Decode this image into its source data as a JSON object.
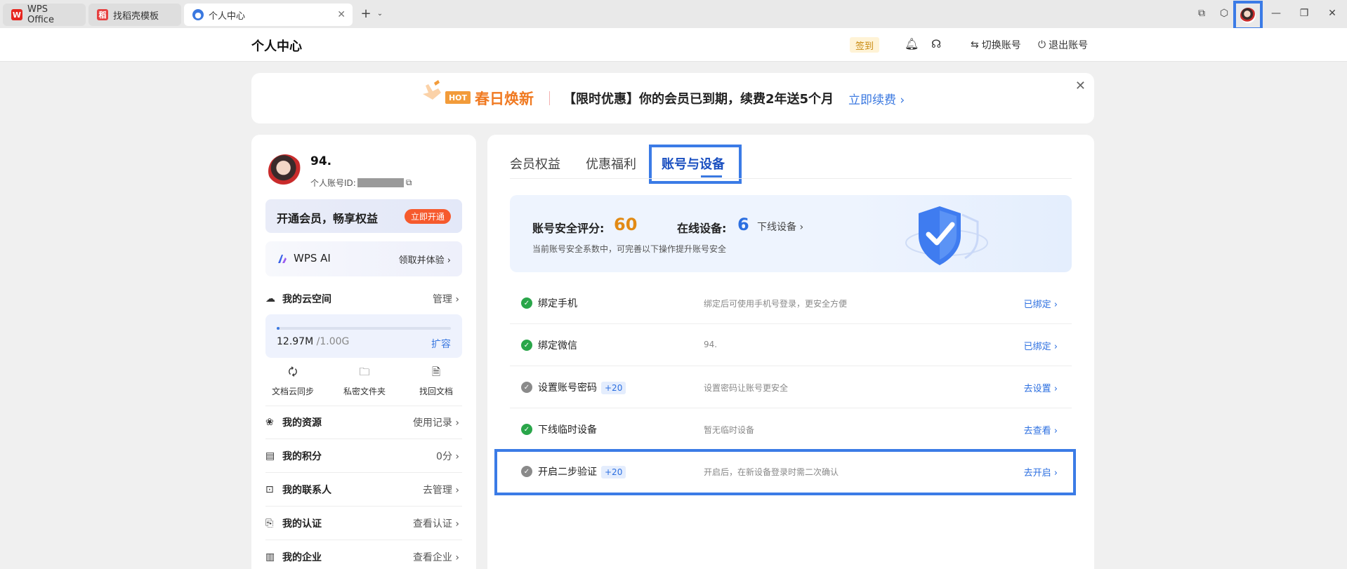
{
  "tabs": [
    {
      "label": "WPS Office",
      "icon": "wps-logo-icon"
    },
    {
      "label": "找稻壳模板",
      "icon": "docer-logo-icon"
    },
    {
      "label": "个人中心",
      "icon": "user-icon"
    }
  ],
  "header": {
    "title": "个人中心",
    "sign_in": "签到",
    "switch_account": "切换账号",
    "logout": "退出账号"
  },
  "banner": {
    "hot": "HOT",
    "title": "春日焕新",
    "promo": "【限时优惠】你的会员已到期，续费2年送5个月",
    "renew": "立即续费 ›"
  },
  "profile": {
    "name": "94.",
    "id_label": "个人账号ID:",
    "vip_text": "开通会员，畅享权益",
    "vip_button": "立即开通",
    "ai_label": "WPS AI",
    "ai_link": "领取并体验 ›"
  },
  "cloud": {
    "label": "我的云空间",
    "manage": "管理 ›",
    "used": "12.97M",
    "total": " /1.00G",
    "expand": "扩容",
    "progress": 0.013,
    "quick": [
      "文档云同步",
      "私密文件夹",
      "找回文档"
    ]
  },
  "menu": [
    {
      "label": "我的资源",
      "right": "使用记录 ›"
    },
    {
      "label": "我的积分",
      "right": "0分 ›"
    },
    {
      "label": "我的联系人",
      "right": "去管理 ›"
    },
    {
      "label": "我的认证",
      "right": "查看认证 ›"
    },
    {
      "label": "我的企业",
      "right": "查看企业 ›"
    }
  ],
  "right_tabs": [
    "会员权益",
    "优惠福利",
    "账号与设备"
  ],
  "security": {
    "score_label": "账号安全评分:",
    "score": "60",
    "online_label": "在线设备:",
    "online": "6",
    "offline_link": "下线设备 ›",
    "desc": "当前账号安全系数中，可完善以下操作提升账号安全"
  },
  "settings": [
    {
      "label": "绑定手机",
      "bonus": "",
      "desc": "绑定后可使用手机号登录，更安全方便",
      "action": "已绑定 ›",
      "done": true
    },
    {
      "label": "绑定微信",
      "bonus": "",
      "desc": "94.",
      "action": "已绑定 ›",
      "done": true
    },
    {
      "label": "设置账号密码",
      "bonus": "+20",
      "desc": "设置密码让账号更安全",
      "action": "去设置 ›",
      "done": false
    },
    {
      "label": "下线临时设备",
      "bonus": "",
      "desc": "暂无临时设备",
      "action": "去查看 ›",
      "done": true
    },
    {
      "label": "开启二步验证",
      "bonus": "+20",
      "desc": "开启后，在新设备登录时需二次确认",
      "action": "去开启 ›",
      "done": false
    }
  ]
}
